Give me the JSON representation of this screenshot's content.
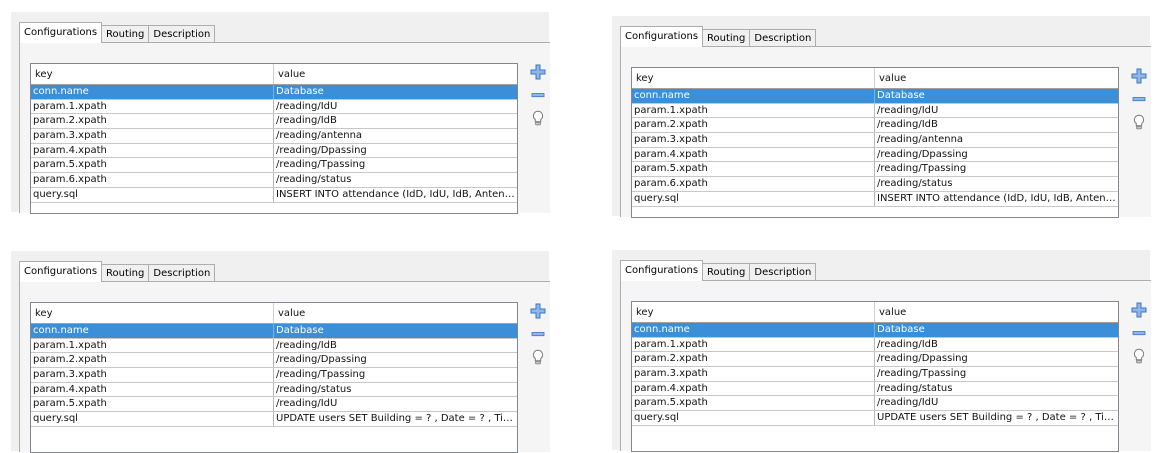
{
  "tabs": [
    "Configurations",
    "Routing",
    "Description"
  ],
  "columns": {
    "key": "key",
    "value": "value"
  },
  "icons": {
    "add": "plus-icon",
    "remove": "minus-icon",
    "hint": "lightbulb-icon"
  },
  "colors": {
    "selection": "#3a8fd8",
    "icon_blue": "#5b8fd6"
  },
  "panels": [
    {
      "rows": [
        {
          "key": "conn.name",
          "value": "Database"
        },
        {
          "key": "param.1.xpath",
          "value": "/reading/IdU"
        },
        {
          "key": "param.2.xpath",
          "value": "/reading/IdB"
        },
        {
          "key": "param.3.xpath",
          "value": "/reading/antenna"
        },
        {
          "key": "param.4.xpath",
          "value": "/reading/Dpassing"
        },
        {
          "key": "param.5.xpath",
          "value": "/reading/Tpassing"
        },
        {
          "key": "param.6.xpath",
          "value": "/reading/status"
        },
        {
          "key": "query.sql",
          "value": "INSERT INTO attendance (IdD, IdU, IdB, Antenn..."
        }
      ]
    },
    {
      "rows": [
        {
          "key": "conn.name",
          "value": "Database"
        },
        {
          "key": "param.1.xpath",
          "value": "/reading/IdU"
        },
        {
          "key": "param.2.xpath",
          "value": "/reading/IdB"
        },
        {
          "key": "param.3.xpath",
          "value": "/reading/antenna"
        },
        {
          "key": "param.4.xpath",
          "value": "/reading/Dpassing"
        },
        {
          "key": "param.5.xpath",
          "value": "/reading/Tpassing"
        },
        {
          "key": "param.6.xpath",
          "value": "/reading/status"
        },
        {
          "key": "query.sql",
          "value": "INSERT INTO attendance (IdD, IdU, IdB, Antenn..."
        }
      ]
    },
    {
      "rows": [
        {
          "key": "conn.name",
          "value": "Database"
        },
        {
          "key": "param.1.xpath",
          "value": "/reading/IdB"
        },
        {
          "key": "param.2.xpath",
          "value": "/reading/Dpassing"
        },
        {
          "key": "param.3.xpath",
          "value": "/reading/Tpassing"
        },
        {
          "key": "param.4.xpath",
          "value": "/reading/status"
        },
        {
          "key": "param.5.xpath",
          "value": "/reading/IdU"
        },
        {
          "key": "query.sql",
          "value": "UPDATE users SET Building = ? , Date = ? , Time ..."
        }
      ]
    },
    {
      "rows": [
        {
          "key": "conn.name",
          "value": "Database"
        },
        {
          "key": "param.1.xpath",
          "value": "/reading/IdB"
        },
        {
          "key": "param.2.xpath",
          "value": "/reading/Dpassing"
        },
        {
          "key": "param.3.xpath",
          "value": "/reading/Tpassing"
        },
        {
          "key": "param.4.xpath",
          "value": "/reading/status"
        },
        {
          "key": "param.5.xpath",
          "value": "/reading/IdU"
        },
        {
          "key": "query.sql",
          "value": "UPDATE users SET Building = ? , Date = ? , Time ..."
        }
      ]
    }
  ]
}
